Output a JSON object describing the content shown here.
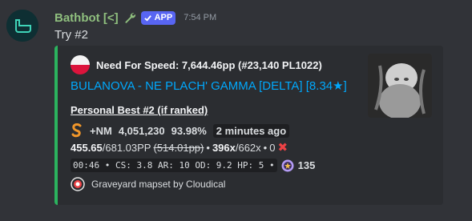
{
  "message": {
    "username": "Bathbot [<]",
    "badge": "APP",
    "timestamp": "7:54 PM",
    "content": "Try #2"
  },
  "embed": {
    "accent_color": "#2bb35e",
    "author": "Need For Speed: 7,644.46pp (#23,140 PL1022)",
    "title": "BULANOVA - NE PLACH' GAMMA [DELTA] [8.34★]",
    "field_name": "Personal Best #2 (if ranked)",
    "mods": "+NM",
    "score": "4,051,230",
    "accuracy": "93.98%",
    "ago": "2 minutes ago",
    "pp": "455.65",
    "max_pp": "/681.03PP",
    "fc_pp": "(514.01pp)",
    "bullet": "•",
    "combo": "396x",
    "max_combo": "/662x",
    "misses": "0",
    "miss_icon": "✖",
    "stats": "00:46 • CS: 3.8 AR: 10 OD: 9.2 HP: 5 •",
    "stars_count": "135",
    "footer": "Graveyard mapset by Cloudical"
  }
}
